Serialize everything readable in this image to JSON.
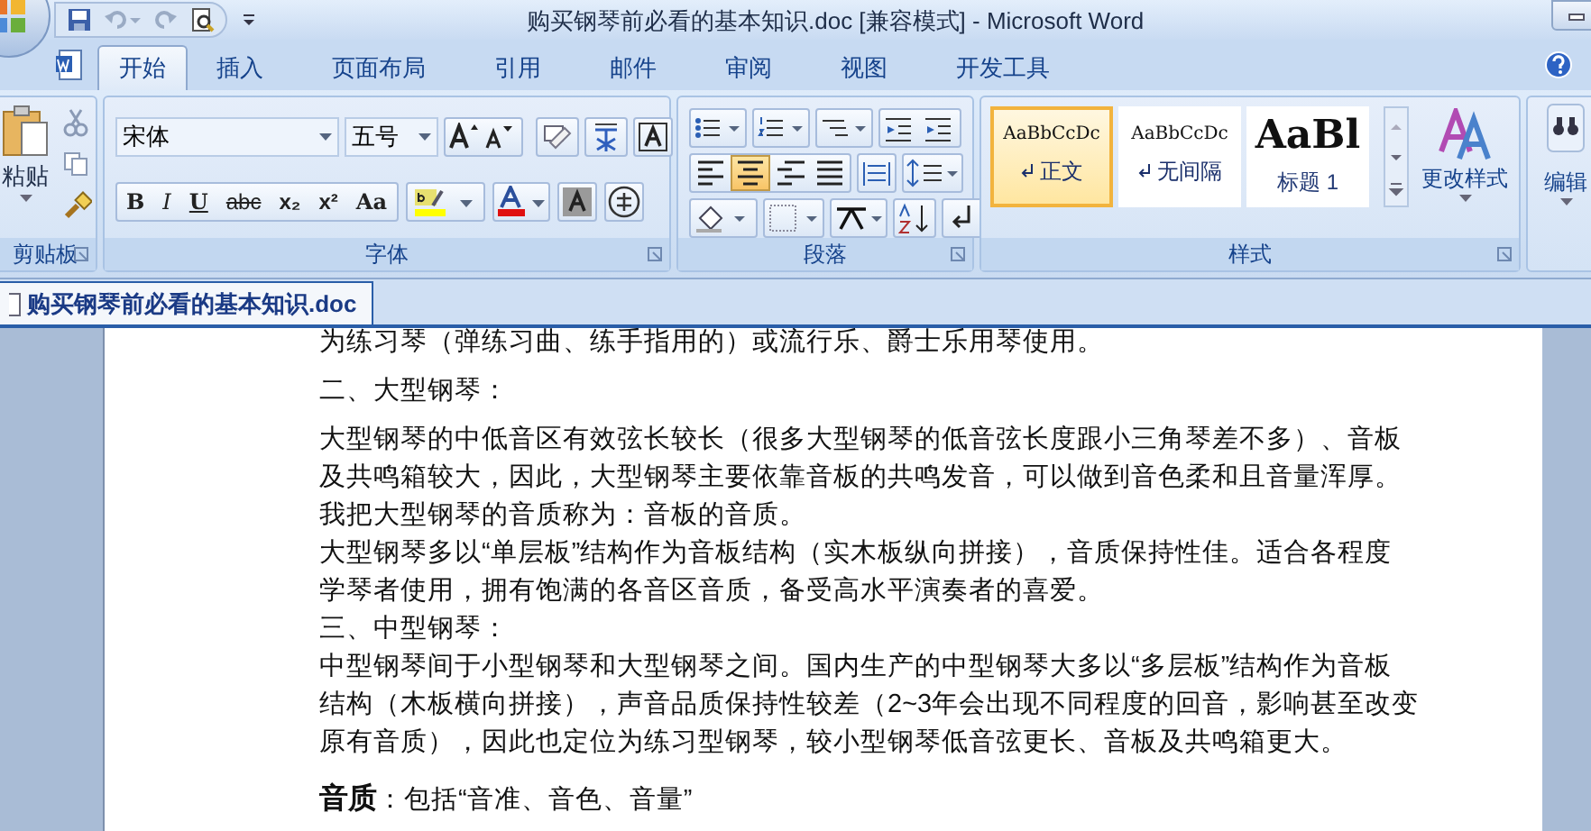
{
  "window": {
    "title": "购买钢琴前必看的基本知识.doc [兼容模式] - Microsoft Word"
  },
  "tabs": [
    {
      "label": "开始",
      "selected": true
    },
    {
      "label": "插入",
      "selected": false
    },
    {
      "label": "页面布局",
      "selected": false
    },
    {
      "label": "引用",
      "selected": false
    },
    {
      "label": "邮件",
      "selected": false
    },
    {
      "label": "审阅",
      "selected": false
    },
    {
      "label": "视图",
      "selected": false
    },
    {
      "label": "开发工具",
      "selected": false
    }
  ],
  "clipboard": {
    "paste": "粘贴",
    "label": "剪贴板"
  },
  "font": {
    "font_name": "宋体",
    "font_size": "五号",
    "format_buttons": [
      "B",
      "I",
      "U",
      "abc",
      "x₂",
      "x²",
      "Aa"
    ],
    "label": "字体"
  },
  "paragraph": {
    "alignment": [
      {
        "selected": false
      },
      {
        "selected": true
      },
      {
        "selected": false
      },
      {
        "selected": false
      }
    ],
    "label": "段落"
  },
  "styles": {
    "items": [
      {
        "preview": "AaBbCcDc",
        "name": "正文",
        "selected": true,
        "kind": "normal"
      },
      {
        "preview": "AaBbCcDc",
        "name": "无间隔",
        "selected": false,
        "kind": "normal"
      },
      {
        "preview": "AaBl",
        "name": "标题 1",
        "selected": false,
        "kind": "heading"
      }
    ],
    "change_styles": "更改样式",
    "label": "样式"
  },
  "editing": {
    "label": "编辑"
  },
  "document_tab": "购买钢琴前必看的基本知识.doc",
  "document": [
    {
      "kind": "plain",
      "lines": [
        "为练习琴（弹练习曲、练手指用的）或流行乐、爵士乐用琴使用。"
      ]
    },
    {
      "kind": "spaced",
      "lines": [
        "二、大型钢琴："
      ]
    },
    {
      "kind": "plain",
      "lines": [
        "大型钢琴的中低音区有效弦长较长（很多大型钢琴的低音弦长度跟小三角琴差不多）、音板",
        "及共鸣箱较大，因此，大型钢琴主要依靠音板的共鸣发音，可以做到音色柔和且音量浑厚。",
        "我把大型钢琴的音质称为：音板的音质。"
      ]
    },
    {
      "kind": "plain",
      "lines": [
        "大型钢琴多以“单层板”结构作为音板结构（实木板纵向拼接），音质保持性佳。适合各程度",
        "学琴者使用，拥有饱满的各音区音质，备受高水平演奏者的喜爱。"
      ]
    },
    {
      "kind": "plain",
      "lines": [
        "三、中型钢琴："
      ]
    },
    {
      "kind": "plain",
      "lines": [
        "中型钢琴间于小型钢琴和大型钢琴之间。国内生产的中型钢琴大多以“多层板”结构作为音板",
        "结构（木板横向拼接），声音品质保持性较差（2~3年会出现不同程度的回音，影响甚至改变",
        "原有音质），因此也定位为练习型钢琴，较小型钢琴低音弦更长、音板及共鸣箱更大。"
      ]
    },
    {
      "kind": "spaced",
      "lines": [
        "**音质**：包括“音准、音色、音量”"
      ]
    }
  ]
}
